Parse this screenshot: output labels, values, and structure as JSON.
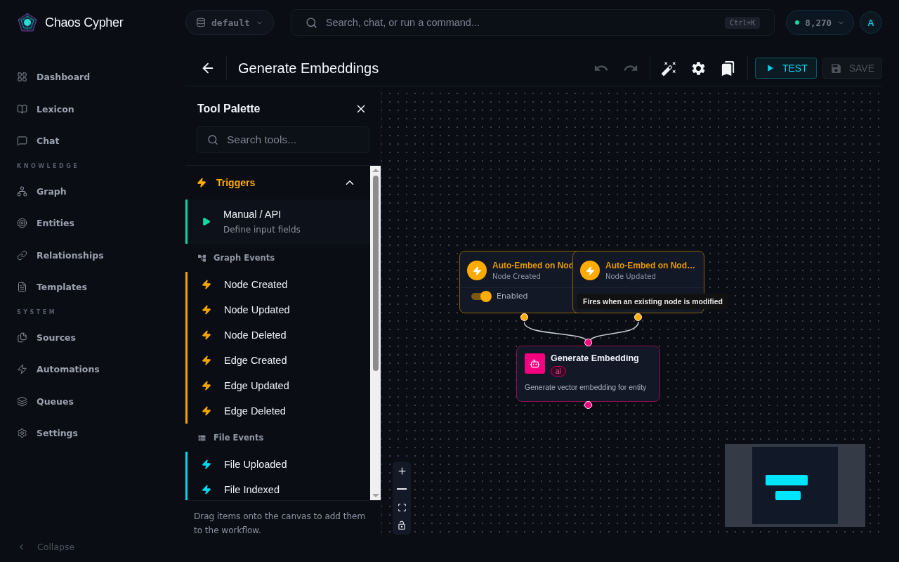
{
  "brand": {
    "name": "Chaos Cypher"
  },
  "topbar": {
    "workspace": "default",
    "search_placeholder": "Search, chat, or run a command...",
    "shortcut": "Ctrl+K",
    "credits": "8,270",
    "avatar": "A"
  },
  "sidebar": {
    "sections": [
      {
        "items": [
          {
            "label": "Dashboard"
          },
          {
            "label": "Lexicon"
          },
          {
            "label": "Chat"
          }
        ]
      },
      {
        "heading": "KNOWLEDGE",
        "items": [
          {
            "label": "Graph"
          },
          {
            "label": "Entities"
          },
          {
            "label": "Relationships"
          },
          {
            "label": "Templates"
          }
        ]
      },
      {
        "heading": "SYSTEM",
        "items": [
          {
            "label": "Sources"
          },
          {
            "label": "Automations"
          },
          {
            "label": "Queues"
          },
          {
            "label": "Settings"
          }
        ]
      }
    ],
    "collapse": "Collapse"
  },
  "editor": {
    "title": "Generate Embeddings",
    "undo": {
      "disabled": true
    },
    "redo": {
      "disabled": true
    },
    "test": "TEST",
    "save": {
      "label": "SAVE",
      "disabled": true
    }
  },
  "palette": {
    "title": "Tool Palette",
    "search_placeholder": "Search tools...",
    "section": {
      "label": "Triggers",
      "expanded": true
    },
    "groups": [
      {
        "kind": "plain",
        "color": "#10d9a0",
        "items": [
          {
            "label": "Manual / API",
            "description": "Define input fields"
          }
        ]
      },
      {
        "kind": "graph",
        "label": "Graph Events",
        "color": "#f5a300",
        "items": [
          {
            "label": "Node Created"
          },
          {
            "label": "Node Updated"
          },
          {
            "label": "Node Deleted"
          },
          {
            "label": "Edge Created"
          },
          {
            "label": "Edge Updated"
          },
          {
            "label": "Edge Deleted"
          }
        ]
      },
      {
        "kind": "file",
        "label": "File Events",
        "color": "#00d8f0",
        "items": [
          {
            "label": "File Uploaded"
          },
          {
            "label": "File Indexed"
          }
        ]
      }
    ],
    "footer": "Drag items onto the canvas to add them to the workflow."
  },
  "canvas": {
    "nodes": [
      {
        "kind": "trigger",
        "title": "Auto-Embed on Nod",
        "subtitle": "Node Created",
        "enabled": true,
        "toggle_label": "Enabled"
      },
      {
        "kind": "trigger",
        "title": "Auto-Embed on Nod…",
        "subtitle": "Node Updated"
      },
      {
        "kind": "ai",
        "title": "Generate Embedding",
        "tag": "ai",
        "description": "Generate vector embedding for entity"
      }
    ],
    "tooltip": "Fires when an existing node is modified"
  }
}
